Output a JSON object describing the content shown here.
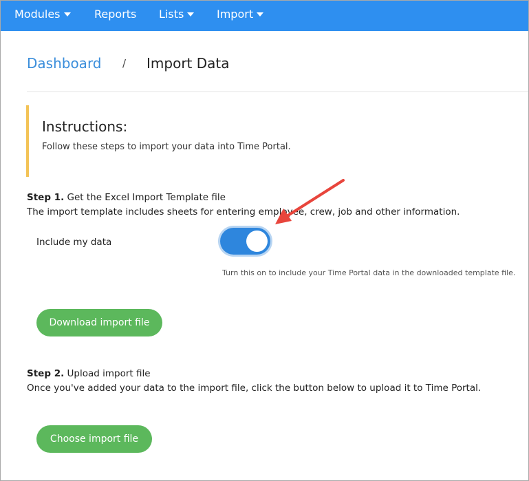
{
  "nav": {
    "items": [
      {
        "label": "Modules",
        "has_caret": true
      },
      {
        "label": "Reports",
        "has_caret": false
      },
      {
        "label": "Lists",
        "has_caret": true
      },
      {
        "label": "Import",
        "has_caret": true
      }
    ]
  },
  "breadcrumb": {
    "link": "Dashboard",
    "separator": "/",
    "current": "Import Data"
  },
  "instructions": {
    "title": "Instructions:",
    "text": "Follow these steps to import your data into Time Portal."
  },
  "step1": {
    "label": "Step 1.",
    "heading": " Get the Excel Import Template file",
    "description": "The import template includes sheets for entering employee, crew, job and other information.",
    "toggle_label": "Include my data",
    "toggle_on": true,
    "hint": "Turn this on to include your Time Portal data in the downloaded template file.",
    "button": "Download import file"
  },
  "step2": {
    "label": "Step 2.",
    "heading": " Upload import file",
    "description": "Once you've added your data to the import file, click the button below to upload it to Time Portal.",
    "button": "Choose import file"
  },
  "colors": {
    "navbar": "#2e8ff0",
    "link": "#3b8edb",
    "accent_border": "#f3c356",
    "button": "#5cb85c",
    "toggle": "#2e86dd",
    "annotation_arrow": "#e8453c"
  }
}
